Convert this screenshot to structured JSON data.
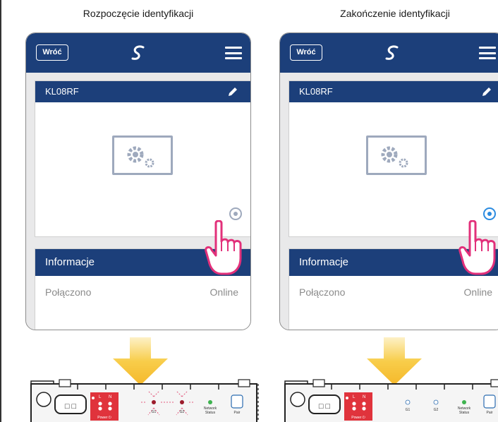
{
  "captions": {
    "left": "Rozpoczęcie identyfikacji",
    "right": "Zakończenie identyfikacji"
  },
  "phones": [
    {
      "header": {
        "back_label": "Wróć",
        "logo_icon": "salus-logo-icon",
        "menu_icon": "hamburger-menu-icon"
      },
      "device": {
        "name": "KL08RF",
        "edit_icon": "pencil-icon",
        "image_icon": "gears-device-icon",
        "identify_icon": "eye-icon",
        "identify_color": "#9ea9bd"
      },
      "info": {
        "title": "Informacje",
        "label": "Połączono",
        "value": "Online"
      }
    },
    {
      "header": {
        "back_label": "Wróć",
        "logo_icon": "salus-logo-icon",
        "menu_icon": "hamburger-menu-icon"
      },
      "device": {
        "name": "KL08RF",
        "edit_icon": "pencil-icon",
        "image_icon": "gears-device-icon",
        "identify_icon": "eye-icon",
        "identify_color": "#2b8be0"
      },
      "info": {
        "title": "Informacje",
        "label": "Połączono",
        "value": "Online"
      }
    }
  ],
  "boards": [
    {
      "socket_label": "□ □",
      "power_terminal": {
        "labels": [
          "L",
          "N"
        ],
        "power_label": "Power ⏻"
      },
      "leds": {
        "g1": "G1",
        "g2": "G2",
        "network": "Network",
        "status": "Status",
        "pair": "Pair"
      },
      "led_state": "blinking-red"
    },
    {
      "socket_label": "□ □",
      "power_terminal": {
        "labels": [
          "L",
          "N"
        ],
        "power_label": "Power ⏻"
      },
      "leds": {
        "g1": "G1",
        "g2": "G2",
        "network": "Network",
        "status": "Status",
        "pair": "Pair"
      },
      "led_state": "off"
    }
  ],
  "colors": {
    "header_blue": "#1c3f7a",
    "arrow_yellow": "#f5c12e",
    "hand_pink": "#e2307a",
    "terminal_red": "#e0333c",
    "network_led_green": "#3eb34f"
  }
}
